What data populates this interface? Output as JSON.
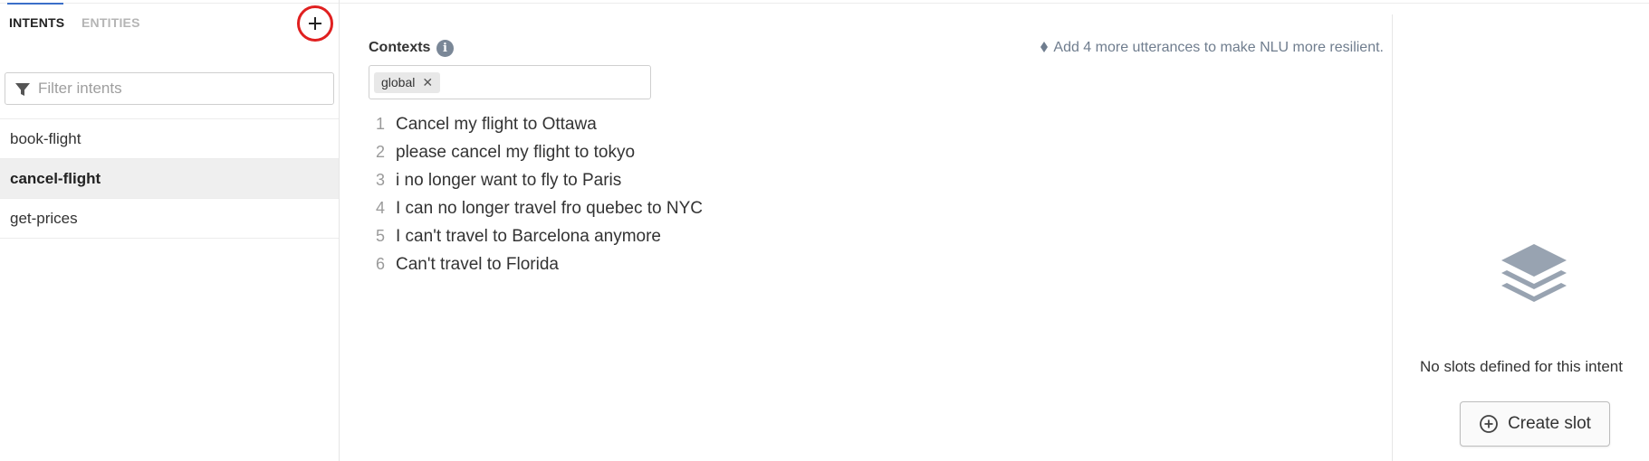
{
  "sidebar": {
    "tabs": [
      {
        "label": "INTENTS",
        "active": true
      },
      {
        "label": "ENTITIES",
        "active": false
      }
    ],
    "add_icon": "plus-icon",
    "filter": {
      "placeholder": "Filter intents",
      "value": "",
      "icon": "filter-icon"
    },
    "intents": [
      {
        "label": "book-flight",
        "selected": false
      },
      {
        "label": "cancel-flight",
        "selected": true
      },
      {
        "label": "get-prices",
        "selected": false
      }
    ]
  },
  "main": {
    "contexts_label": "Contexts",
    "info_icon": "info-icon",
    "hint": "Add 4 more utterances to make NLU more resilient.",
    "hint_icon": "diamond-icon",
    "contexts": [
      {
        "label": "global",
        "close": "✕"
      }
    ],
    "utterances": [
      {
        "num": "1",
        "text": "Cancel my flight to Ottawa"
      },
      {
        "num": "2",
        "text": "please cancel my flight to tokyo"
      },
      {
        "num": "3",
        "text": "i no longer want to fly to Paris"
      },
      {
        "num": "4",
        "text": "I can no longer travel fro quebec to NYC"
      },
      {
        "num": "5",
        "text": "I can't travel to Barcelona anymore"
      },
      {
        "num": "6",
        "text": "Can't travel to Florida"
      }
    ]
  },
  "slots_panel": {
    "icon": "layers-icon",
    "empty_text": "No slots defined for this intent",
    "create_button": "Create slot",
    "create_icon": "plus-circle-icon"
  },
  "colors": {
    "accent": "#3b6fc9",
    "highlight_circle": "#e02020",
    "muted_icon": "#98a3b1",
    "selected_row": "#efefef"
  }
}
